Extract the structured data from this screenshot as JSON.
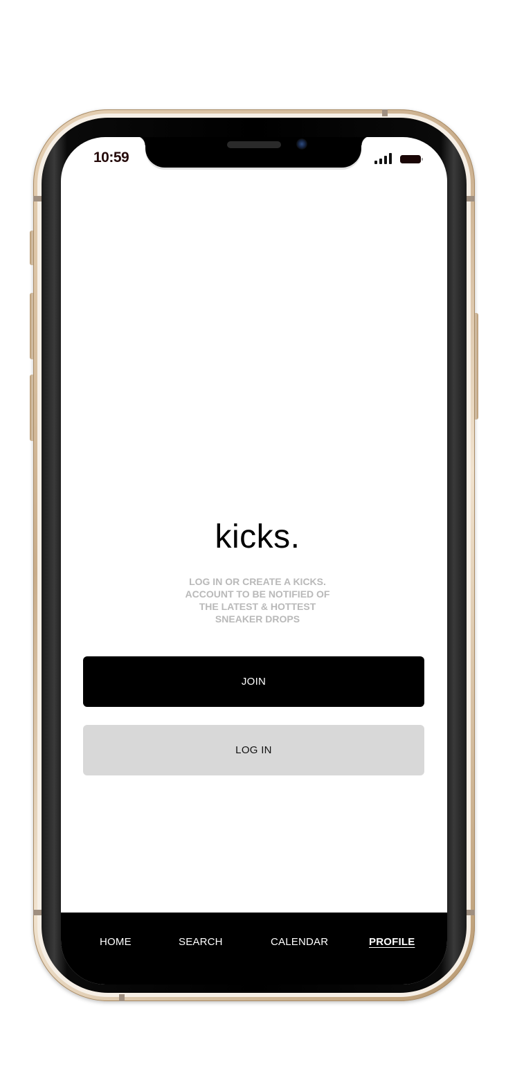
{
  "status_bar": {
    "time": "10:59",
    "signal_icon": "cellular-signal-icon",
    "battery_icon": "battery-icon"
  },
  "main": {
    "brand": "kicks.",
    "tagline": "LOG IN OR CREATE A KICKS. ACCOUNT TO BE NOTIFIED OF THE LATEST & HOTTEST SNEAKER DROPS",
    "join_label": "JOIN",
    "login_label": "LOG IN"
  },
  "tabbar": {
    "items": [
      {
        "label": "HOME"
      },
      {
        "label": "SEARCH"
      },
      {
        "label": "CALENDAR"
      },
      {
        "label": "PROFILE",
        "active": true
      }
    ]
  },
  "colors": {
    "primary": "#000000",
    "secondary_button": "#d8d8d8",
    "muted_text": "#b9b9b9",
    "frame_gold": "#c9ad8b"
  }
}
